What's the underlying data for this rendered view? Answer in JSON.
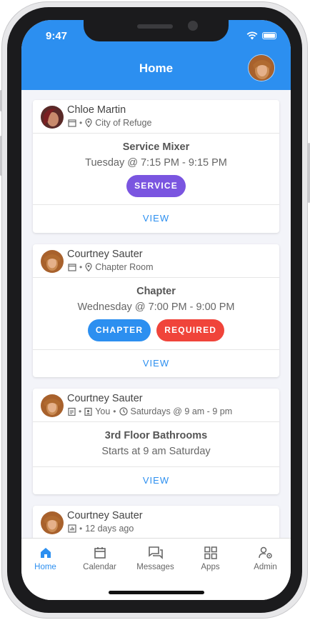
{
  "status_bar": {
    "time": "9:47"
  },
  "header": {
    "title": "Home"
  },
  "feed": [
    {
      "author": "Chloe Martin",
      "meta_separator": "•",
      "location": "City of Refuge",
      "title": "Service Mixer",
      "subtitle": "Tuesday @ 7:15 PM - 9:15 PM",
      "tags": [
        {
          "label": "SERVICE",
          "color": "#7a55e0"
        }
      ],
      "action": "VIEW"
    },
    {
      "author": "Courtney Sauter",
      "meta_separator": "•",
      "location": "Chapter Room",
      "title": "Chapter",
      "subtitle": "Wednesday @ 7:00 PM - 9:00 PM",
      "tags": [
        {
          "label": "CHAPTER",
          "color": "#2c8ff0"
        },
        {
          "label": "REQUIRED",
          "color": "#f0443a"
        }
      ],
      "action": "VIEW"
    },
    {
      "author": "Courtney Sauter",
      "meta_separator": "•",
      "assignee": "You",
      "schedule": "Saturdays @ 9 am - 9 pm",
      "title": "3rd Floor Bathrooms",
      "subtitle": "Starts at 9 am Saturday",
      "action": "VIEW"
    },
    {
      "author": "Courtney Sauter",
      "meta_separator": "•",
      "time_ago": "12 days ago"
    }
  ],
  "bottom_nav": [
    {
      "label": "Home",
      "icon": "home-icon",
      "active": true
    },
    {
      "label": "Calendar",
      "icon": "calendar-icon",
      "active": false
    },
    {
      "label": "Messages",
      "icon": "messages-icon",
      "active": false
    },
    {
      "label": "Apps",
      "icon": "apps-icon",
      "active": false
    },
    {
      "label": "Admin",
      "icon": "admin-icon",
      "active": false
    }
  ],
  "colors": {
    "primary": "#2c8ff0",
    "service": "#7a55e0",
    "required": "#f0443a"
  }
}
